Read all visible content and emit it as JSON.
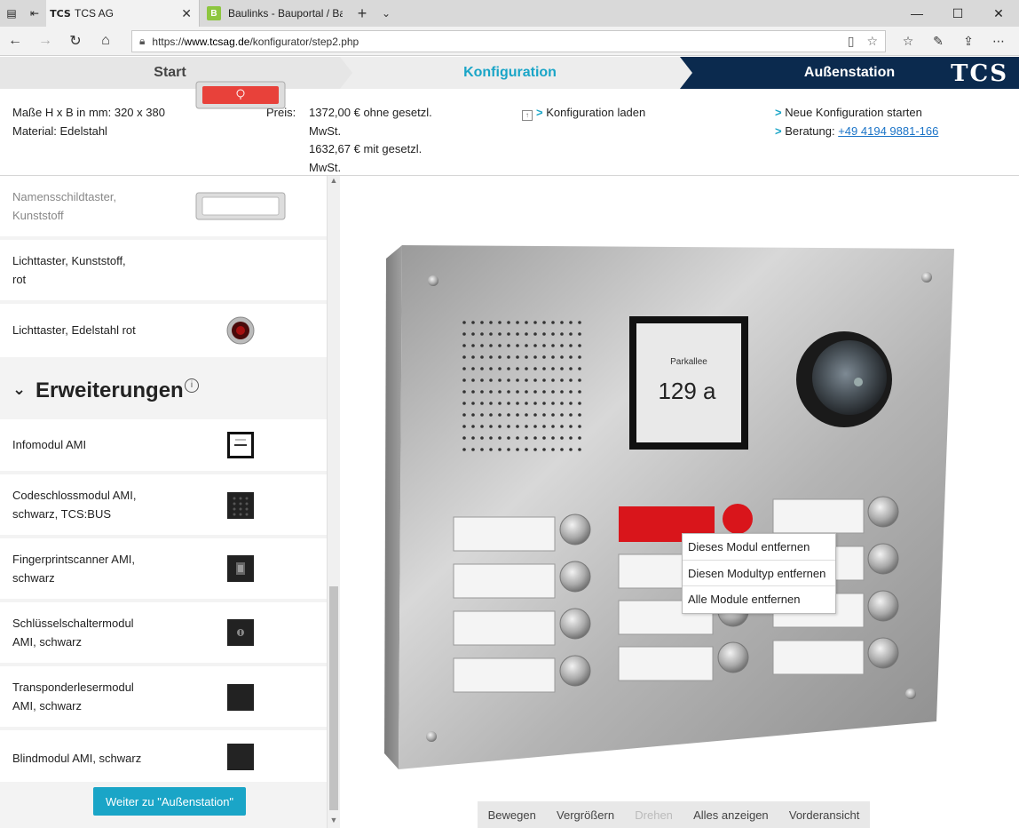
{
  "browser": {
    "tabs": [
      {
        "title": "TCS AG",
        "favicon": "TCS"
      },
      {
        "title": "Baulinks - Bauportal / Baum",
        "favicon": "B"
      }
    ],
    "url_prefix": "https://",
    "url_host": "www.tcsag.de",
    "url_path": "/konfigurator/step2.php"
  },
  "steps": {
    "start": "Start",
    "konfiguration": "Konfiguration",
    "aussenstation": "Außenstation",
    "logo": "TCS"
  },
  "info": {
    "dimensions": "Maße H x B in mm: 320 x 380",
    "material": "Material: Edelstahl",
    "price_label": "Preis:",
    "price_net_1": "1372,00 € ohne gesetzl.",
    "price_net_2": "MwSt.",
    "price_gross_1": "1632,67 € mit gesetzl.",
    "price_gross_2": "MwSt.",
    "arrow": ">",
    "load_config": "Konfiguration laden",
    "new_config": "Neue Konfiguration starten",
    "advice_label": "Beratung:",
    "advice_phone": "+49 4194 9881-166"
  },
  "left_panel": {
    "items_top": [
      {
        "name_1": "Namensschildtaster,",
        "name_2": "Kunststoff"
      },
      {
        "name_1": "Lichttaster, Kunststoff,",
        "name_2": "rot"
      },
      {
        "name_1": "Lichttaster, Edelstahl rot",
        "name_2": ""
      }
    ],
    "section_title": "Erweiterungen",
    "section_info": "i",
    "items_ext": [
      {
        "name_1": "Infomodul AMI",
        "name_2": ""
      },
      {
        "name_1": "Codeschlossmodul AMI,",
        "name_2": "schwarz, TCS:BUS"
      },
      {
        "name_1": "Fingerprintscanner AMI,",
        "name_2": "schwarz"
      },
      {
        "name_1": "Schlüsselschaltermodul",
        "name_2": "AMI, schwarz"
      },
      {
        "name_1": "Transponderlesermodul",
        "name_2": "AMI, schwarz"
      },
      {
        "name_1": "Blindmodul AMI, schwarz",
        "name_2": ""
      }
    ],
    "cta": "Weiter zu \"Außenstation\""
  },
  "viewer": {
    "display_street": "Parkallee",
    "display_number": "129 a",
    "context_menu": [
      "Dieses Modul entfernen",
      "Diesen Modultyp entfernen",
      "Alle Module entfernen"
    ],
    "toolbar": [
      "Bewegen",
      "Vergrößern",
      "Drehen",
      "Alles anzeigen",
      "Vorderansicht"
    ]
  },
  "colors": {
    "accent": "#1aa5c7",
    "navy": "#0b2a4e",
    "red_button": "#d9151b"
  }
}
